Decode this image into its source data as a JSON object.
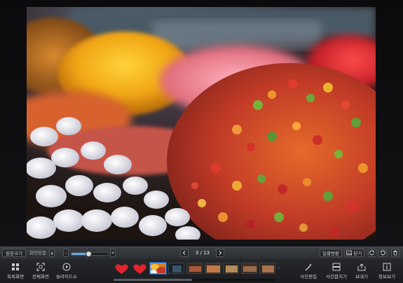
{
  "photo": {
    "subject": "candy-photo"
  },
  "toolbar": {
    "original_size": "원본크기",
    "fit_screen": "화면맞춤",
    "zoom_minus": "-",
    "zoom_plus": "+",
    "zoom_level": 0.45,
    "page_indicator": "3 / 13",
    "bulk_convert": "일괄변환",
    "close": "닫기"
  },
  "actions": {
    "list_view": "목록화면",
    "fullscreen": "전체화면",
    "slideshow": "슬라이드쇼",
    "edit_photo": "사진편집",
    "combine_photo": "사진합치기",
    "send": "보내기",
    "info": "정보보기"
  },
  "thumbnails": {
    "more": "··",
    "scroll_position": 0.49
  },
  "colors": {
    "accent": "#4aa0ff",
    "heart": "#e0242d"
  }
}
